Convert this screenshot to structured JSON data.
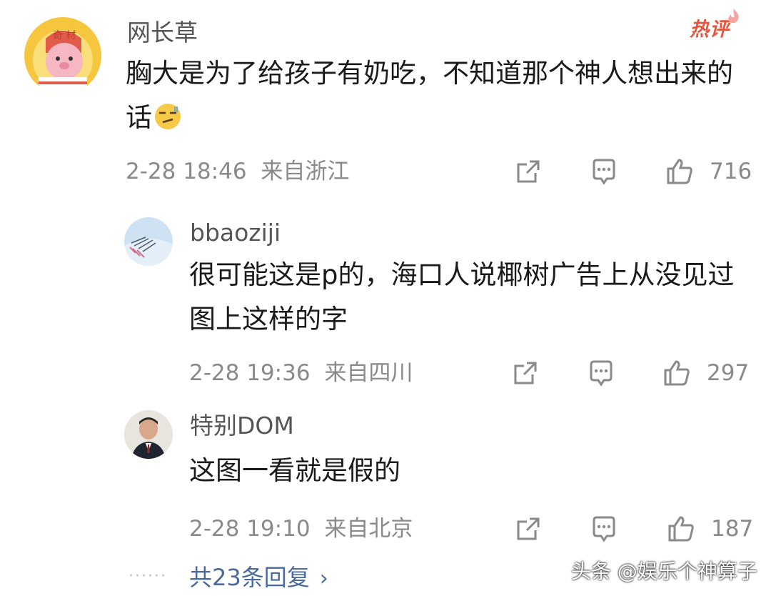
{
  "badge": {
    "label": "热评"
  },
  "comment": {
    "username": "网长草",
    "text": "胸大是为了给孩子有奶吃，不知道那个神人想出来的话",
    "emoji": "smirk-emoji",
    "timestamp": "2-28 18:46",
    "location": "来自浙江",
    "likes": "716"
  },
  "replies": [
    {
      "username": "bbaoziji",
      "text": "很可能这是p的，海口人说椰树广告上从没见过图上这样的字",
      "timestamp": "2-28 19:36",
      "location": "来自四川",
      "likes": "297"
    },
    {
      "username": "特别DOM",
      "text": "这图一看就是假的",
      "timestamp": "2-28 19:10",
      "location": "来自北京",
      "likes": "187"
    }
  ],
  "more": {
    "dots": "······",
    "label": "共23条回复",
    "chevron": "›"
  },
  "watermark": "头条 @娱乐个神算子",
  "icons": {
    "share": "share-icon",
    "comment": "comment-icon",
    "like": "thumbs-up-icon"
  },
  "colors": {
    "hot_badge": "#e8553e",
    "link": "#4a6a9c",
    "meta": "#8a8a8a"
  }
}
